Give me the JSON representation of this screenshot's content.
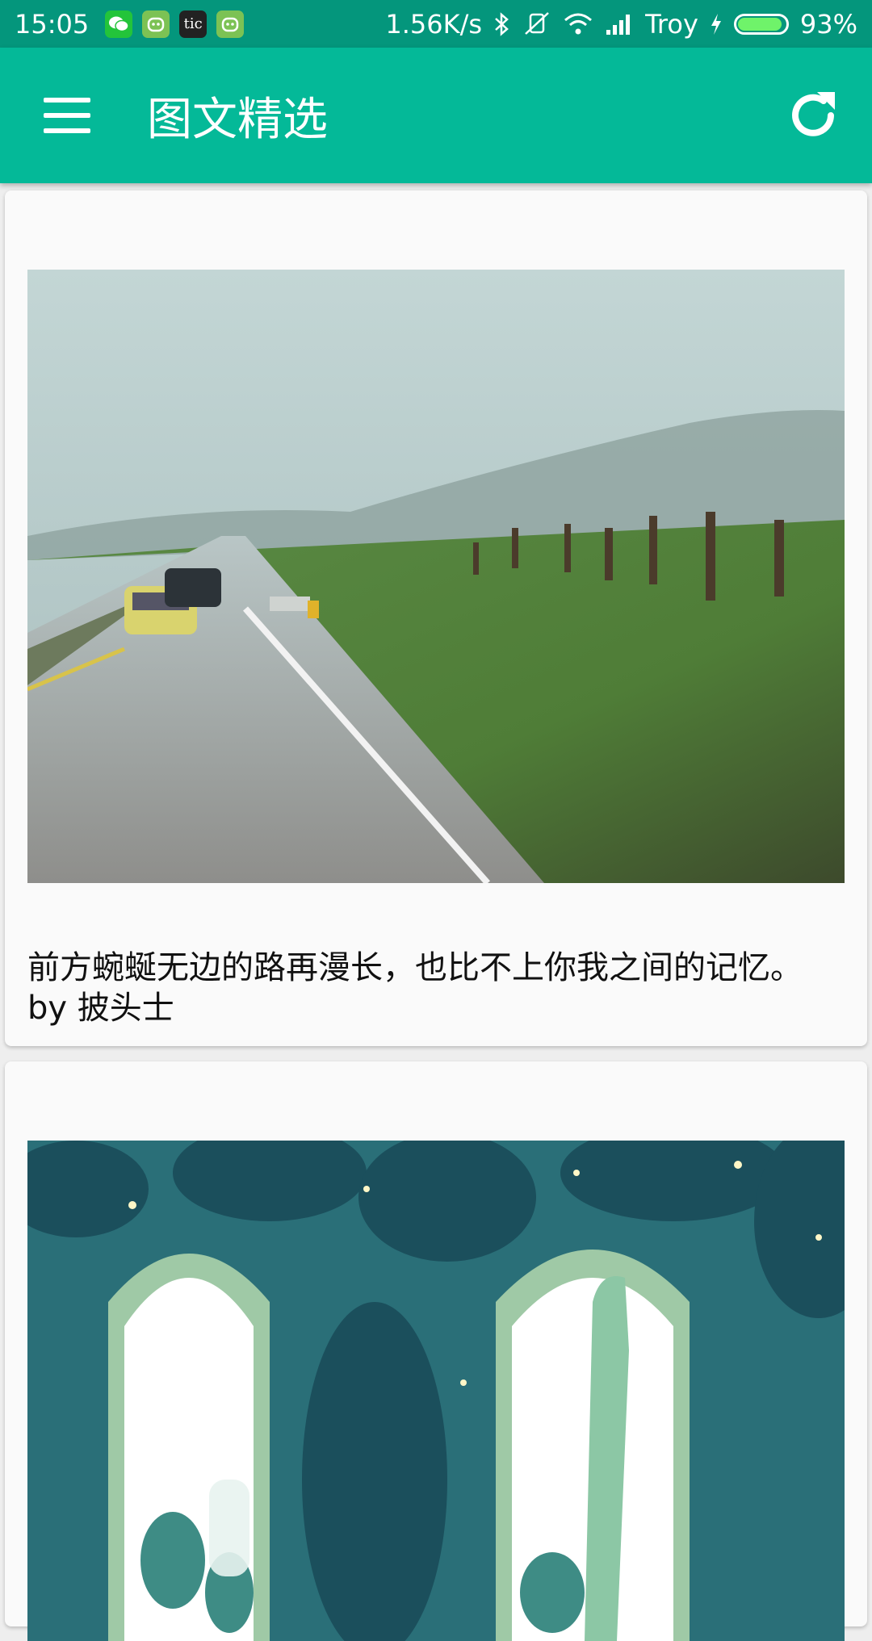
{
  "status_bar": {
    "time": "15:05",
    "network_speed": "1.56K/s",
    "carrier": "Troy",
    "battery": "93%",
    "battery_level": 0.93,
    "app_icons": [
      "wechat-icon",
      "android-icon",
      "tic-icon",
      "android-icon"
    ],
    "tic_label": "tic"
  },
  "toolbar": {
    "title": "图文精选",
    "color": "#04b998"
  },
  "cards": [
    {
      "caption": "前方蜿蜒无边的路再漫长，也比不上你我之间的记忆。\nby 披头士",
      "image": "rainy-road-photo"
    },
    {
      "caption": "",
      "image": "jungle-arch-illustration"
    }
  ]
}
